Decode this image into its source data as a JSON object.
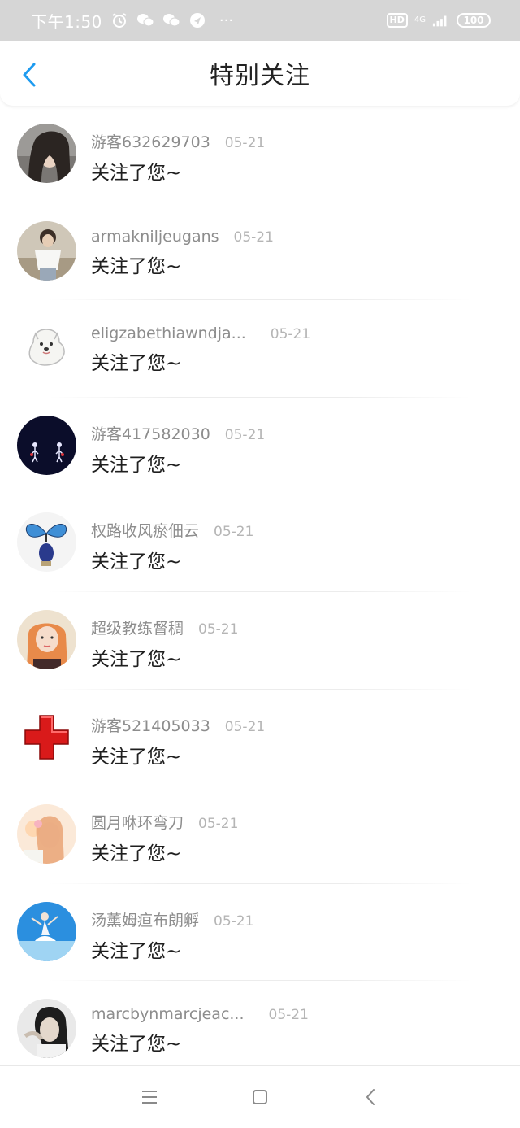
{
  "status_bar": {
    "time": "下午1:50",
    "hd_label": "HD",
    "network_label": "4G",
    "battery_level": "100",
    "more_label": "···",
    "icons": [
      "alarm-icon",
      "wechat-icon",
      "wechat-icon",
      "app-notification-icon"
    ]
  },
  "header": {
    "title": "特别关注",
    "back_icon": "chevron-left-icon",
    "accent_color": "#1d9bf0"
  },
  "items": [
    {
      "name": "游客632629703",
      "date": "05-21",
      "message": "关注了您~",
      "avatar": "portrait-girl-dark-hair"
    },
    {
      "name": "armakniljeugans",
      "date": "05-21",
      "message": "关注了您~",
      "avatar": "person-white-shirt"
    },
    {
      "name": "eligzabethiawndja...",
      "date": "05-21",
      "message": "关注了您~",
      "avatar": "white-dog-drawing"
    },
    {
      "name": "游客417582030",
      "date": "05-21",
      "message": "关注了您~",
      "avatar": "night-couple-figures"
    },
    {
      "name": "权路收风瘀佃云",
      "date": "05-21",
      "message": "关注了您~",
      "avatar": "blue-butterfly"
    },
    {
      "name": "超级教练督稠",
      "date": "05-21",
      "message": "关注了您~",
      "avatar": "girl-orange-hair"
    },
    {
      "name": "游客521405033",
      "date": "05-21",
      "message": "关注了您~",
      "avatar": "red-cross"
    },
    {
      "name": "圆月咻环弯刀",
      "date": "05-21",
      "message": "关注了您~",
      "avatar": "girl-flower-pastel"
    },
    {
      "name": "汤薰姆疸布朗孵",
      "date": "05-21",
      "message": "关注了您~",
      "avatar": "dancer-blue-sky"
    },
    {
      "name": "marcbynmarcjeac...",
      "date": "05-21",
      "message": "关注了您~",
      "avatar": "portrait-bw"
    }
  ],
  "nav_bar": {
    "buttons": [
      "menu-icon",
      "home-icon",
      "back-icon"
    ]
  }
}
